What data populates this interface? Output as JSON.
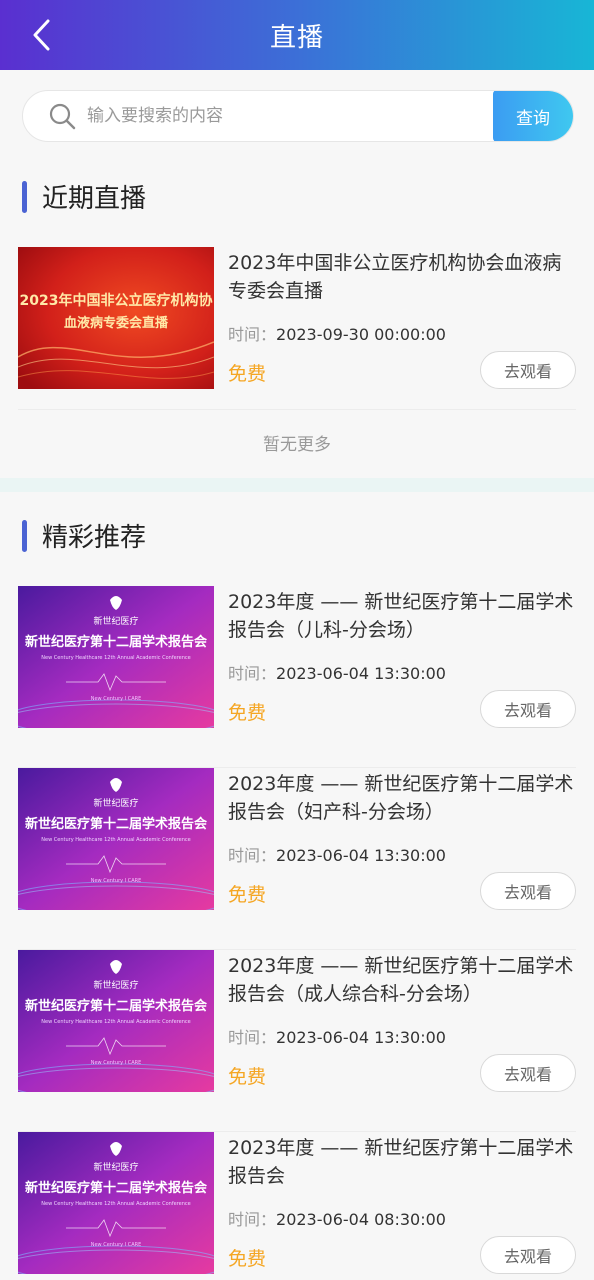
{
  "header": {
    "title": "直播"
  },
  "search": {
    "placeholder": "输入要搜索的内容",
    "button": "查询"
  },
  "recent": {
    "title": "近期直播",
    "items": [
      {
        "thumb_line1": "2023年中国非公立医疗机构协",
        "thumb_line2": "血液病专委会直播",
        "title": "2023年中国非公立医疗机构协会血液病专委会直播",
        "time_label": "时间：",
        "time": "2023-09-30 00:00:00",
        "price": "免费",
        "action": "去观看"
      }
    ],
    "no_more": "暂无更多"
  },
  "featured": {
    "title": "精彩推荐",
    "thumb_logo": "新世纪医疗",
    "thumb_title": "新世纪医疗第十二届学术报告会",
    "thumb_sub": "New Century Healthcare 12th Annual Academic Conference",
    "thumb_tag": "New Century I CARE",
    "items": [
      {
        "title": "2023年度 —— 新世纪医疗第十二届学术报告会（儿科-分会场）",
        "time_label": "时间：",
        "time": "2023-06-04 13:30:00",
        "price": "免费",
        "action": "去观看"
      },
      {
        "title": "2023年度 —— 新世纪医疗第十二届学术报告会（妇产科-分会场）",
        "time_label": "时间：",
        "time": "2023-06-04 13:30:00",
        "price": "免费",
        "action": "去观看"
      },
      {
        "title": "2023年度 —— 新世纪医疗第十二届学术报告会（成人综合科-分会场）",
        "time_label": "时间：",
        "time": "2023-06-04 13:30:00",
        "price": "免费",
        "action": "去观看"
      },
      {
        "title": "2023年度 —— 新世纪医疗第十二届学术报告会",
        "time_label": "时间：",
        "time": "2023-06-04 08:30:00",
        "price": "免费",
        "action": "去观看"
      }
    ]
  },
  "colors": {
    "header_start": "#5a2fd0",
    "header_end": "#18b6d6",
    "accent_bar": "#4b63d3",
    "price": "#f5a623",
    "search_button": "#3b9cf2"
  }
}
